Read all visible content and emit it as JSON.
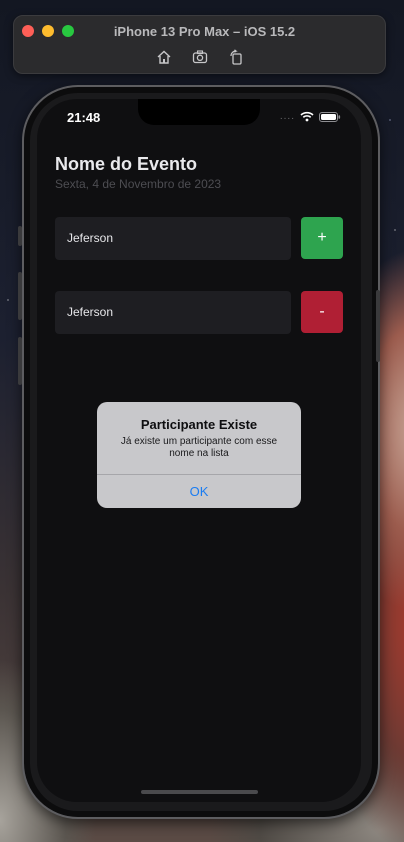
{
  "simulator": {
    "title": "iPhone 13 Pro Max – iOS 15.2",
    "toolbar_icons": [
      "home-icon",
      "screenshot-icon",
      "rotate-icon"
    ]
  },
  "status_bar": {
    "time": "21:48",
    "signal": "....",
    "icons": [
      "wifi-icon",
      "battery-icon"
    ]
  },
  "event": {
    "title": "Nome do Evento",
    "date": "Sexta, 4 de Novembro de 2023"
  },
  "rows": [
    {
      "name": "Jeferson",
      "button": "+",
      "button_color": "#2ea44f"
    },
    {
      "name": "Jeferson",
      "button": "-",
      "button_color": "#b01f34"
    }
  ],
  "alert": {
    "title": "Participante Existe",
    "message": "Já existe um participante com esse nome na lista",
    "ok_label": "OK",
    "ok_color": "#1a7cf2"
  }
}
